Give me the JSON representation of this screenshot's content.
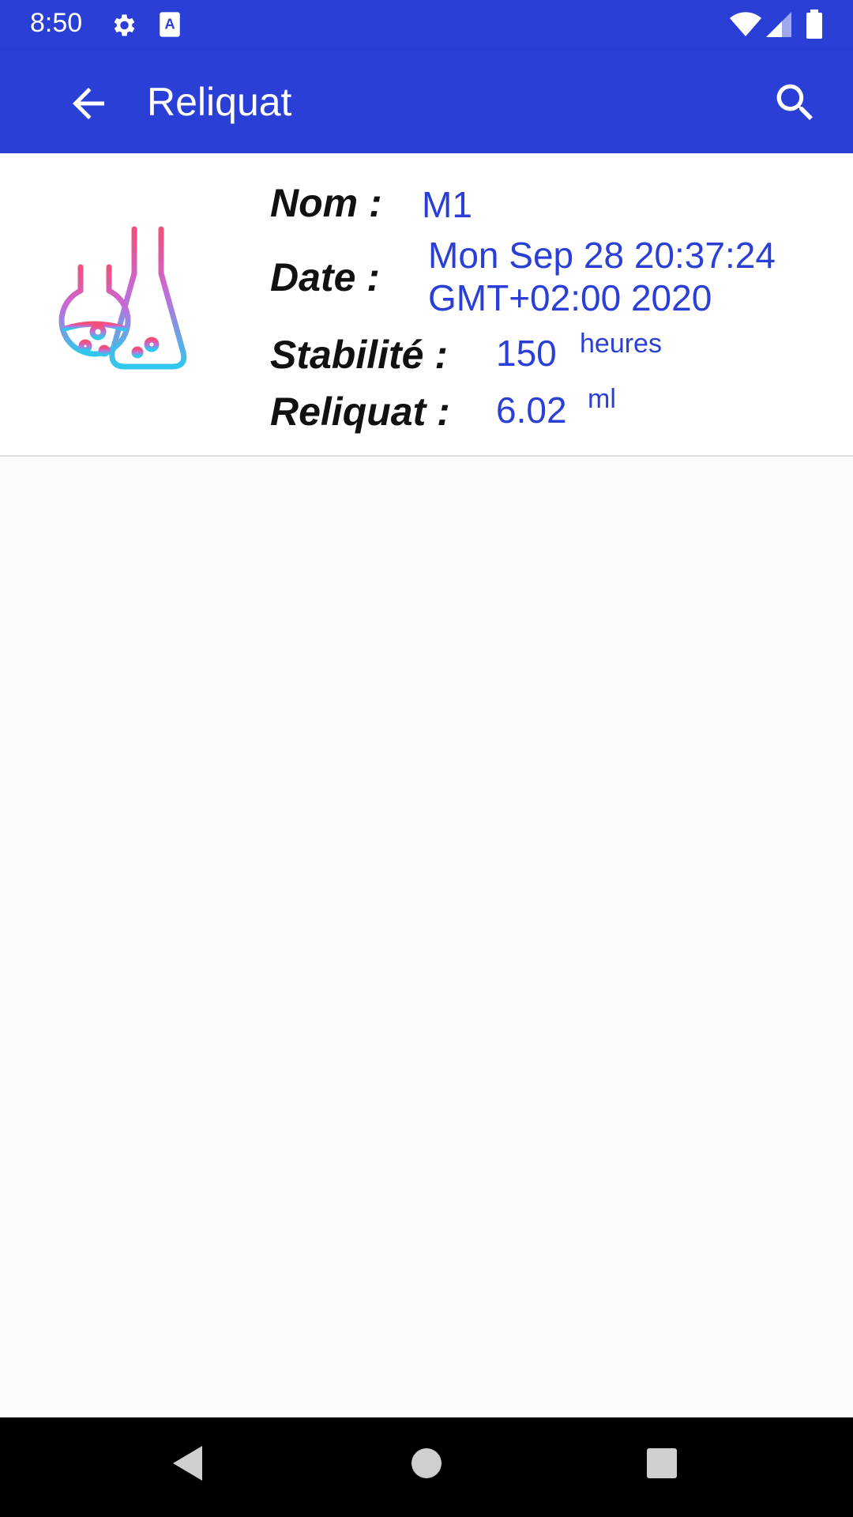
{
  "status_bar": {
    "time": "8:50",
    "icons": [
      "gear-icon",
      "text-a-icon",
      "wifi-icon",
      "signal-icon",
      "battery-icon"
    ]
  },
  "app_bar": {
    "title": "Reliquat",
    "back_icon": "arrow-left-icon",
    "search_icon": "search-icon",
    "color": "#2a3fd6"
  },
  "item": {
    "icon": "lab-flasks-icon",
    "nom_label": "Nom :",
    "nom_value": "M1",
    "date_label": "Date :",
    "date_line1": "Mon Sep 28 20:37:24",
    "date_line2": "GMT+02:00 2020",
    "stabilite_label": "Stabilité :",
    "stabilite_value": "150",
    "stabilite_unit": "heures",
    "reliquat_label": "Reliquat :",
    "reliquat_value": "6.02",
    "reliquat_unit": "ml",
    "value_color": "#2a3fd6"
  },
  "nav_bar": {
    "buttons": [
      "back-triangle-icon",
      "home-circle-icon",
      "recents-square-icon"
    ]
  }
}
